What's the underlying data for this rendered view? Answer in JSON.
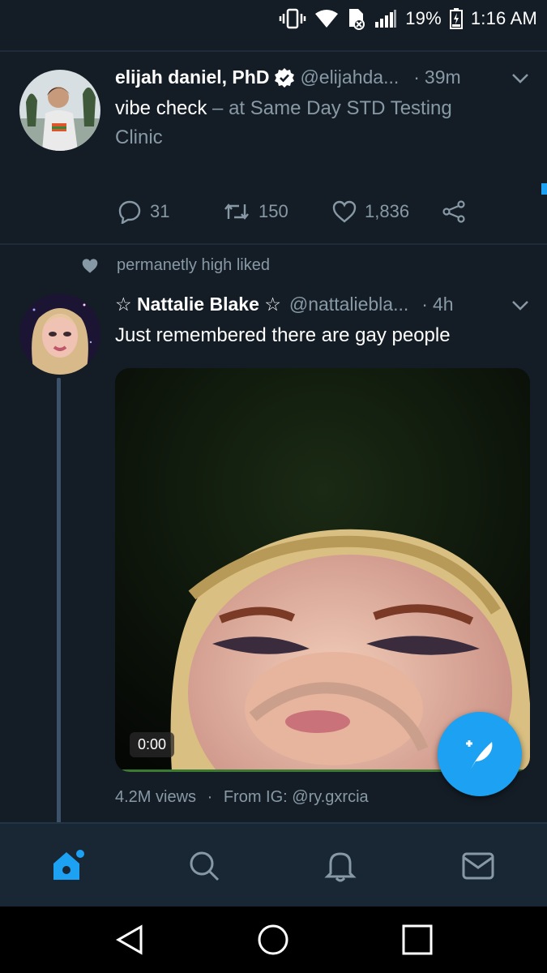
{
  "status_bar": {
    "battery": "19%",
    "time": "1:16 AM"
  },
  "tweets": [
    {
      "name": "elijah daniel, PhD",
      "handle": "@elijahda...",
      "time_sep": "·",
      "time": "39m",
      "text": "vibe check",
      "checkin": " – at Same Day STD Testing Clinic",
      "replies": "31",
      "retweets": "150",
      "likes": "1,836"
    },
    {
      "liked_by": "permanetly high liked",
      "name": "☆ Nattalie Blake ☆",
      "handle": "@nattaliebla...",
      "time_sep": "·",
      "time": "4h",
      "text": "Just remembered there are gay people",
      "video_time": "0:00",
      "views": "4.2M views",
      "meta_sep": "·",
      "source": "From IG: @ry.gxrcia"
    }
  ],
  "colors": {
    "background": "#141d26",
    "accent": "#1da1f2",
    "muted": "#8899a6",
    "nav": "#192734"
  },
  "icons": {
    "nav": [
      "home-icon",
      "search-icon",
      "notifications-icon",
      "messages-icon"
    ],
    "android": [
      "back-icon",
      "home-circle-icon",
      "recents-icon"
    ]
  }
}
